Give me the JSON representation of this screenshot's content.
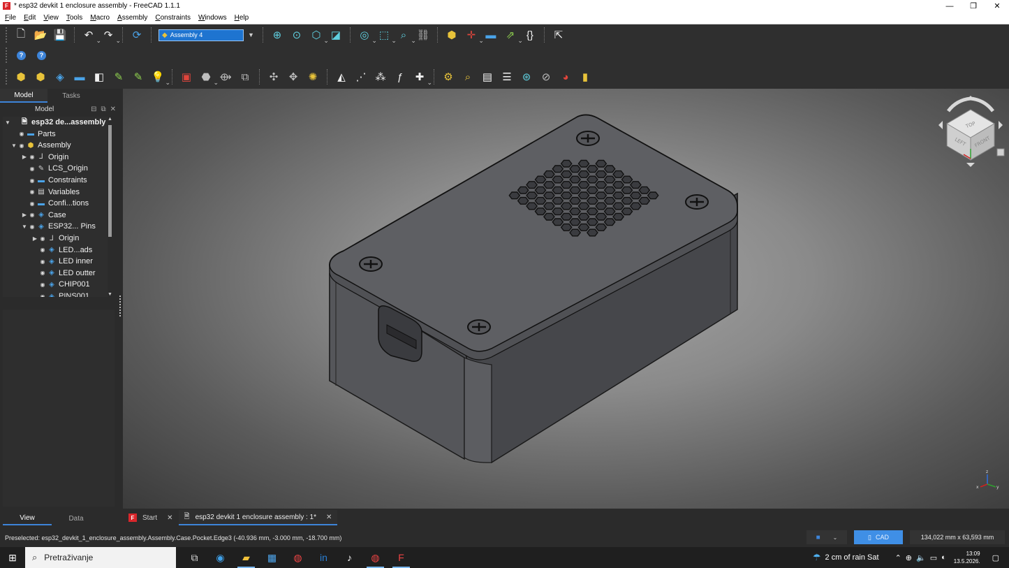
{
  "window": {
    "title": "* esp32 devkit 1 enclosure assembly - FreeCAD 1.1.1",
    "app_icon_letter": "F",
    "controls": [
      "—",
      "❐",
      "✕"
    ]
  },
  "menu": [
    "File",
    "Edit",
    "View",
    "Tools",
    "Macro",
    "Assembly",
    "Constraints",
    "Windows",
    "Help"
  ],
  "toolbar": {
    "workbench_selector": "Assembly 4"
  },
  "left_panel": {
    "tabs": [
      "Model",
      "Tasks"
    ],
    "header_title": "Model",
    "tree": [
      {
        "label": "esp32 de...assembly",
        "icon": "document-icon",
        "level": 0,
        "twisty": "▼",
        "bold": true
      },
      {
        "label": "Parts",
        "icon": "folder-icon",
        "level": 1,
        "twisty": ""
      },
      {
        "label": "Assembly",
        "icon": "assembly-icon",
        "level": 1,
        "twisty": "▼"
      },
      {
        "label": "Origin",
        "icon": "origin-icon",
        "level": 2,
        "twisty": "▶"
      },
      {
        "label": "LCS_Origin",
        "icon": "lcs-icon",
        "level": 2,
        "twisty": ""
      },
      {
        "label": "Constraints",
        "icon": "folder-icon",
        "level": 2,
        "twisty": ""
      },
      {
        "label": "Variables",
        "icon": "variables-icon",
        "level": 2,
        "twisty": ""
      },
      {
        "label": "Confi...tions",
        "icon": "folder-icon",
        "level": 2,
        "twisty": ""
      },
      {
        "label": "Case",
        "icon": "part-icon",
        "level": 2,
        "twisty": "▶"
      },
      {
        "label": "ESP32... Pins",
        "icon": "part-icon",
        "level": 2,
        "twisty": "▼"
      },
      {
        "label": "Origin",
        "icon": "origin-icon",
        "level": 3,
        "twisty": "▶"
      },
      {
        "label": "LED...ads",
        "icon": "body-icon",
        "level": 3,
        "twisty": ""
      },
      {
        "label": "LED inner",
        "icon": "body-icon",
        "level": 3,
        "twisty": ""
      },
      {
        "label": "LED outter",
        "icon": "body-icon",
        "level": 3,
        "twisty": ""
      },
      {
        "label": "CHIP001",
        "icon": "body-icon",
        "level": 3,
        "twisty": ""
      },
      {
        "label": "PINS001",
        "icon": "body-icon",
        "level": 3,
        "twisty": ""
      }
    ],
    "bottom_tabs": [
      "View",
      "Data"
    ]
  },
  "nav_cube": {
    "faces": [
      "TOP",
      "FRONT",
      "LEFT"
    ]
  },
  "doc_tabs": [
    {
      "label": "Start",
      "active": false
    },
    {
      "label": "esp32 devkit 1 enclosure assembly : 1*",
      "active": true
    }
  ],
  "statusbar": {
    "message": "Preselected: esp32_devkit_1_enclosure_assembly.Assembly.Case.Pocket.Edge3 (-40.936 mm, -3.000 mm, -18.700 mm)",
    "nav_style": "CAD",
    "dimensions": "134,022 mm x 63,593 mm"
  },
  "taskbar": {
    "search_placeholder": "Pretraživanje",
    "weather": "2 cm of rain Sat",
    "time": "13:09",
    "date": "13.5.2026."
  }
}
